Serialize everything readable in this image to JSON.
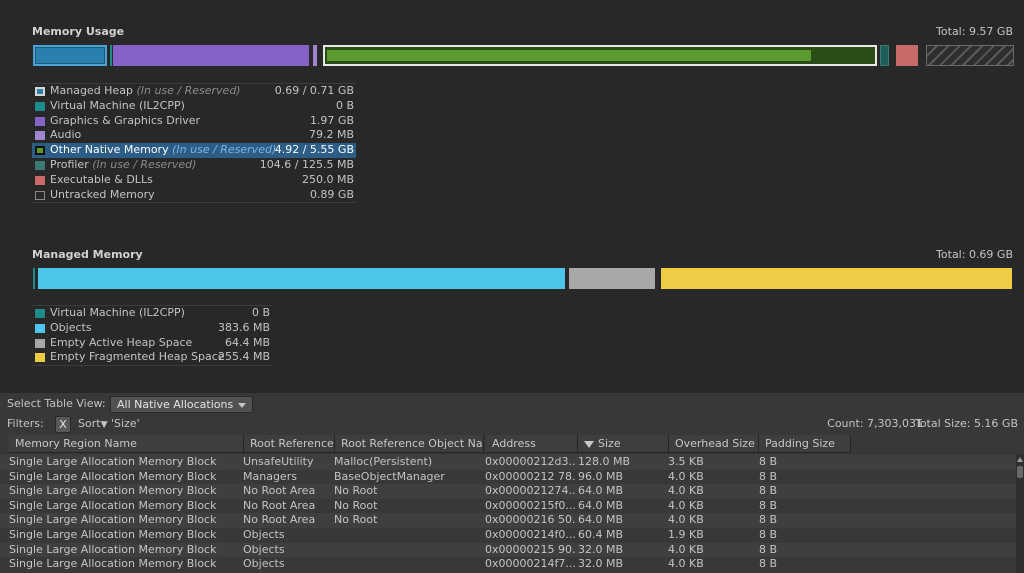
{
  "memory_usage": {
    "title": "Memory Usage",
    "total": "Total: 9.57 GB",
    "legend": [
      {
        "label": "Managed Heap",
        "sub": "(In use / Reserved)",
        "value": "0.69 / 0.71 GB",
        "color": "#2b7fae"
      },
      {
        "label": "Virtual Machine (IL2CPP)",
        "sub": "",
        "value": "0 B",
        "color": "#1f8a8a"
      },
      {
        "label": "Graphics & Graphics Driver",
        "sub": "",
        "value": "1.97 GB",
        "color": "#8462c8"
      },
      {
        "label": "Audio",
        "sub": "",
        "value": "79.2 MB",
        "color": "#9f86cf"
      },
      {
        "label": "Other Native Memory",
        "sub": "(In use / Reserved)",
        "value": "4.92 / 5.55 GB",
        "color": "#5b9a2e",
        "selected": true
      },
      {
        "label": "Profiler",
        "sub": "(In use / Reserved)",
        "value": "104.6 / 125.5 MB",
        "color": "#3a7a72"
      },
      {
        "label": "Executable & DLLs",
        "sub": "",
        "value": "250.0 MB",
        "color": "#c66a6a"
      },
      {
        "label": "Untracked Memory",
        "sub": "",
        "value": "0.89 GB",
        "color": "#555555"
      }
    ]
  },
  "managed_memory": {
    "title": "Managed Memory",
    "total": "Total: 0.69 GB",
    "legend": [
      {
        "label": "Virtual Machine (IL2CPP)",
        "value": "0 B",
        "color": "#1f8a8a"
      },
      {
        "label": "Objects",
        "value": "383.6 MB",
        "color": "#4ec6ec"
      },
      {
        "label": "Empty Active Heap Space",
        "value": "64.4 MB",
        "color": "#a8a8a8"
      },
      {
        "label": "Empty Fragmented Heap Space",
        "value": "255.4 MB",
        "color": "#efcc45"
      }
    ]
  },
  "table_view": {
    "select_label": "Select Table View:",
    "view_value": "All Native Allocations",
    "filters_label": "Filters:",
    "clear_filter": "X",
    "sort_label": "Sort",
    "sort_value": "'Size'",
    "count": "Count: 7,303,031",
    "total_size": "Total Size: 5.16 GB"
  },
  "table": {
    "columns": [
      "Memory Region Name",
      "Root Reference",
      "Root Reference Object Name",
      "Address",
      "Size",
      "Overhead Size",
      "Padding Size"
    ],
    "rows": [
      [
        "Single Large Allocation Memory Block",
        "UnsafeUtility",
        "Malloc(Persistent)",
        "0x00000212d3...",
        "128.0 MB",
        "3.5 KB",
        "8 B"
      ],
      [
        "Single Large Allocation Memory Block",
        "Managers",
        "BaseObjectManager",
        "0x00000212 78...",
        "96.0 MB",
        "4.0 KB",
        "8 B"
      ],
      [
        "Single Large Allocation Memory Block",
        "No Root Area",
        "No Root",
        "0x0000021274...",
        "64.0 MB",
        "4.0 KB",
        "8 B"
      ],
      [
        "Single Large Allocation Memory Block",
        "No Root Area",
        "No Root",
        "0x00000215f0...",
        "64.0 MB",
        "4.0 KB",
        "8 B"
      ],
      [
        "Single Large Allocation Memory Block",
        "No Root Area",
        "No Root",
        "0x00000216 50...",
        "64.0 MB",
        "4.0 KB",
        "8 B"
      ],
      [
        "Single Large Allocation Memory Block",
        "Objects",
        "",
        "0x00000214f0...",
        "60.4 MB",
        "1.9 KB",
        "8 B"
      ],
      [
        "Single Large Allocation Memory Block",
        "Objects",
        "",
        "0x00000215 90...",
        "32.0 MB",
        "4.0 KB",
        "8 B"
      ],
      [
        "Single Large Allocation Memory Block",
        "Objects",
        "",
        "0x00000214f7...",
        "32.0 MB",
        "4.0 KB",
        "8 B"
      ]
    ]
  }
}
